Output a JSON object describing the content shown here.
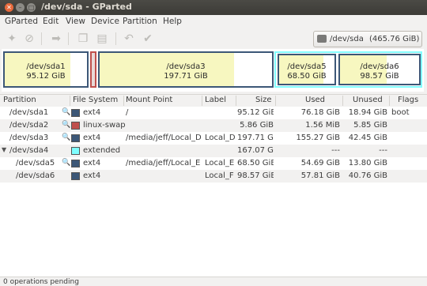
{
  "window": {
    "title": "/dev/sda - GParted"
  },
  "menu": [
    "GParted",
    "Edit",
    "View",
    "Device",
    "Partition",
    "Help"
  ],
  "toolbar": {
    "icons": [
      "new-partition-icon",
      "delete-icon",
      "resize-move-icon",
      "copy-icon",
      "paste-icon",
      "undo-icon",
      "apply-icon"
    ]
  },
  "device_selector": {
    "device": "/dev/sda",
    "size": "(465.76 GiB)"
  },
  "colors": {
    "ext4": "#3c5777",
    "linux_swap": "#c0504d",
    "extended": "#80ffff",
    "used_fill": "#f7f7c0"
  },
  "diskbar": [
    {
      "name": "/dev/sda1",
      "size": "95.12 GiB",
      "used_fraction": 0.8
    },
    {
      "name": "",
      "size": ""
    },
    {
      "name": "/dev/sda3",
      "size": "197.71 GiB",
      "used_fraction": 0.78
    },
    {
      "name": "/dev/sda5",
      "size": "68.50 GiB",
      "used_fraction": 0.8
    },
    {
      "name": "/dev/sda6",
      "size": "98.57 GiB",
      "used_fraction": 0.59
    }
  ],
  "columns": [
    "Partition",
    "File System",
    "Mount Point",
    "Label",
    "Size",
    "Used",
    "Unused",
    "Flags"
  ],
  "rows": [
    {
      "partition": "/dev/sda1",
      "fs": "ext4",
      "mount": "/",
      "label": "",
      "size": "95.12 GiB",
      "used": "76.18 GiB",
      "unused": "18.94 GiB",
      "flags": "boot"
    },
    {
      "partition": "/dev/sda2",
      "fs": "linux-swap",
      "mount": "",
      "label": "",
      "size": "5.86 GiB",
      "used": "1.56 MiB",
      "unused": "5.85 GiB",
      "flags": ""
    },
    {
      "partition": "/dev/sda3",
      "fs": "ext4",
      "mount": "/media/jeff/Local_D",
      "label": "Local_D",
      "size": "197.71 GiB",
      "used": "155.27 GiB",
      "unused": "42.45 GiB",
      "flags": ""
    },
    {
      "partition": "/dev/sda4",
      "fs": "extended",
      "mount": "",
      "label": "",
      "size": "167.07 GiB",
      "used": "---",
      "unused": "---",
      "flags": ""
    },
    {
      "partition": "/dev/sda5",
      "fs": "ext4",
      "mount": "/media/jeff/Local_E",
      "label": "Local_E",
      "size": "68.50 GiB",
      "used": "54.69 GiB",
      "unused": "13.80 GiB",
      "flags": ""
    },
    {
      "partition": "/dev/sda6",
      "fs": "ext4",
      "mount": "",
      "label": "Local_F",
      "size": "98.57 GiB",
      "used": "57.81 GiB",
      "unused": "40.76 GiB",
      "flags": ""
    }
  ],
  "status": {
    "text": "0 operations pending"
  }
}
